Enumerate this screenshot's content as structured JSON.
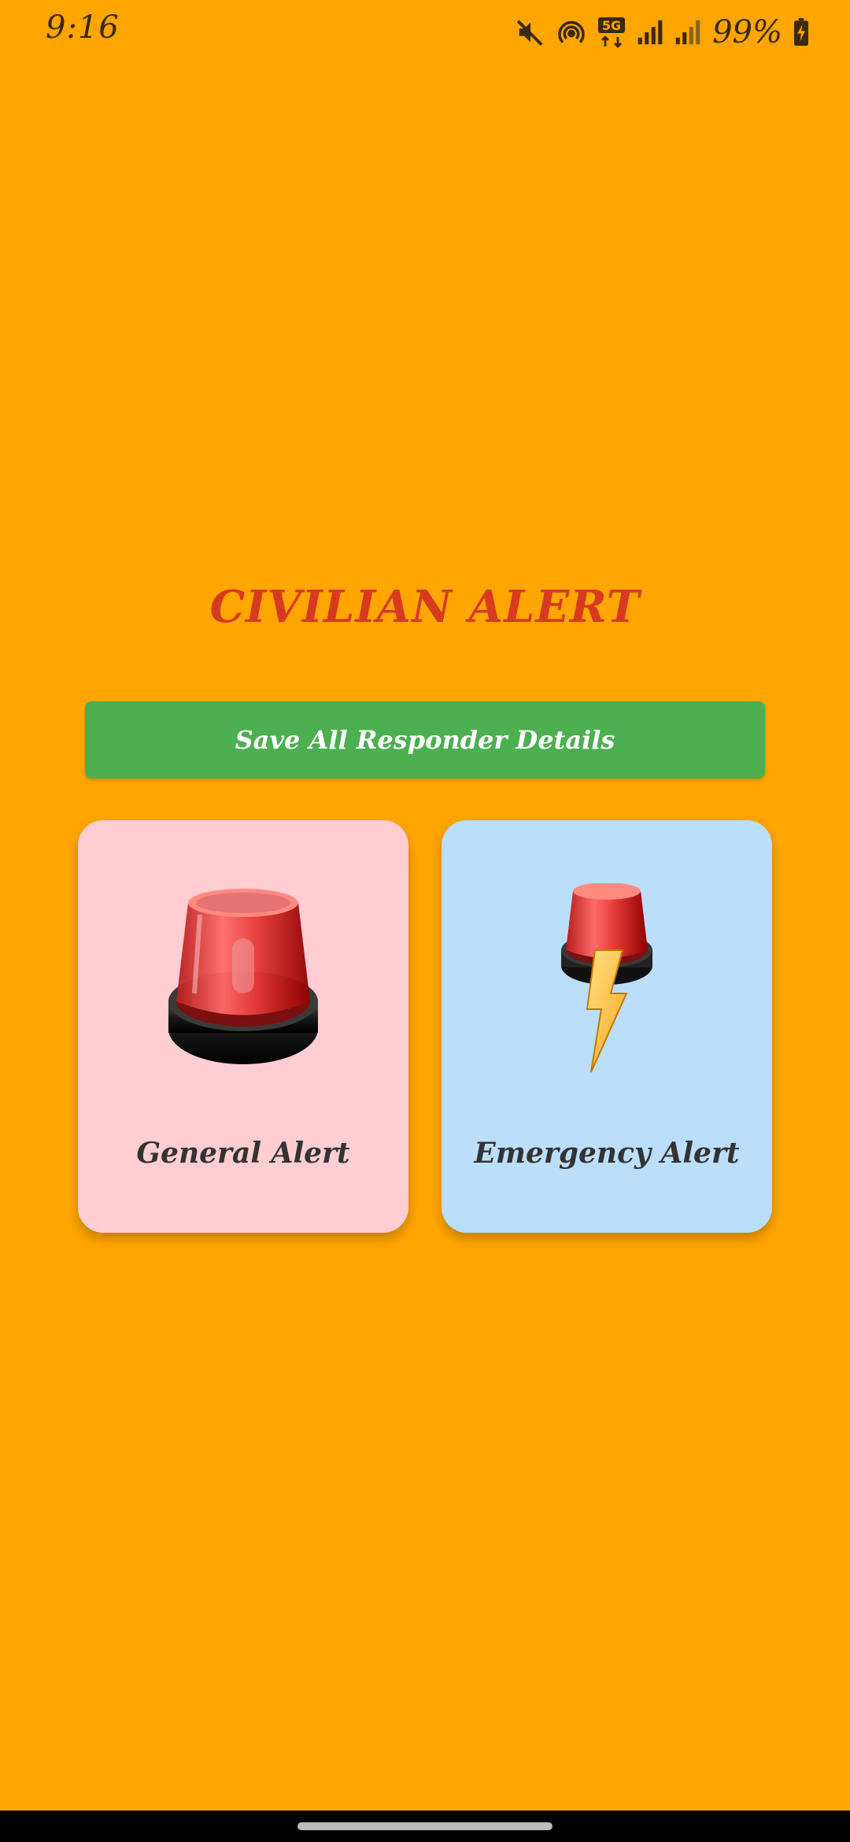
{
  "status_bar": {
    "time": "9:16",
    "battery": "99%",
    "network": "5G",
    "icons": [
      "mute-icon",
      "hotspot-icon",
      "5g-icon",
      "signal-icon",
      "signal-icon",
      "battery-charging-icon"
    ]
  },
  "title": "CIVILIAN ALERT",
  "save_button": {
    "label": "Save All Responder Details",
    "color": "#4CAF50"
  },
  "cards": [
    {
      "label": "General Alert",
      "icon": "siren-icon",
      "color": "#FFCDD2"
    },
    {
      "label": "Emergency Alert",
      "icon": "siren-lightning-icon",
      "color": "#BBDEFB"
    }
  ],
  "colors": {
    "background": "#FFA500",
    "title": "#D73A1F"
  }
}
